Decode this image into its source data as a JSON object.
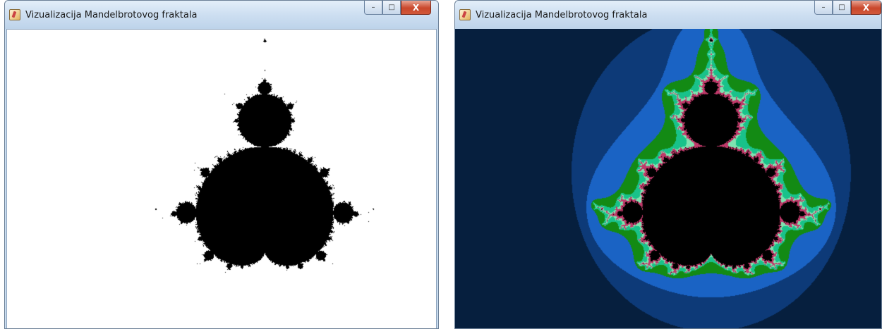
{
  "windows": [
    {
      "title": "Vizualizacija Mandelbrotovog fraktala",
      "controls": {
        "minimize": "–",
        "maximize": "□",
        "close": "X"
      },
      "view": "monochrome"
    },
    {
      "title": "Vizualizacija Mandelbrotovog fraktala",
      "controls": {
        "minimize": "–",
        "maximize": "□",
        "close": "X"
      },
      "view": "colored"
    }
  ],
  "colors": {
    "set_fill": "#000000",
    "mono_background": "#ffffff",
    "bands": [
      "#061f3e",
      "#0d3a78",
      "#1a63c4",
      "#138a14",
      "#19c28a",
      "#7fe3b0",
      "#c0396a"
    ]
  }
}
